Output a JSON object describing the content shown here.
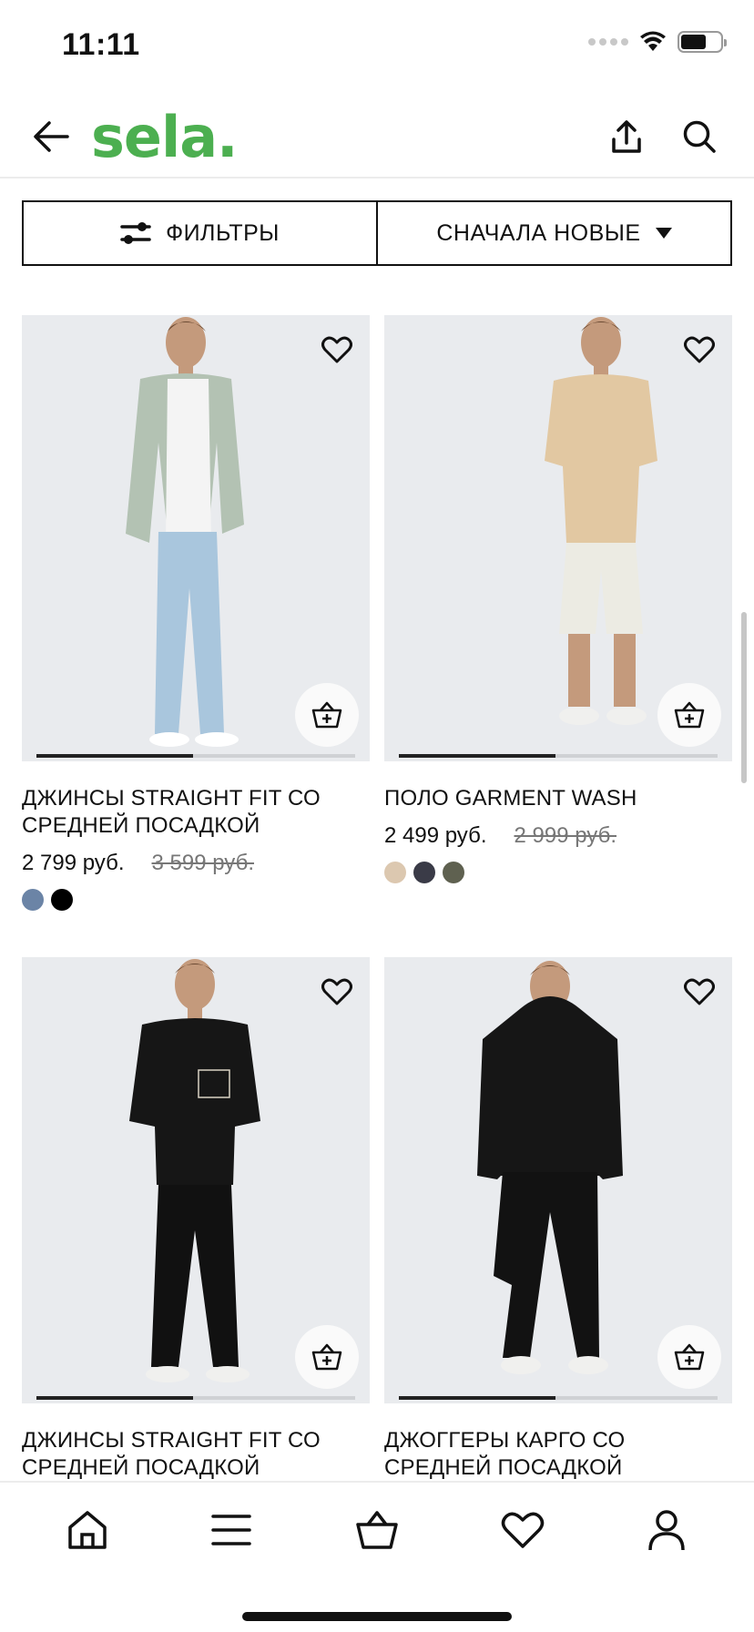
{
  "status_bar": {
    "time": "11:11"
  },
  "header": {
    "logo": "sela."
  },
  "filters": {
    "filter_label": "ФИЛЬТРЫ",
    "sort_label": "СНАЧАЛА НОВЫЕ"
  },
  "products": [
    {
      "name": "ДЖИНСЫ STRAIGHT FIT СО СРЕДНЕЙ ПОСАДКОЙ",
      "price": "2 799 руб.",
      "old_price": "3 599 руб.",
      "swatches": [
        "#6b84a6",
        "#000000"
      ],
      "image_progress": 0.49
    },
    {
      "name": "ПОЛО GARMENT WASH",
      "price": "2 499 руб.",
      "old_price": "2 999 руб.",
      "swatches": [
        "#dcc8b0",
        "#3a3b47",
        "#5f6150"
      ],
      "image_progress": 0.49
    },
    {
      "name": "ДЖИНСЫ STRAIGHT FIT СО СРЕДНЕЙ ПОСАДКОЙ",
      "price": "",
      "old_price": "",
      "swatches": [],
      "image_progress": 0.49
    },
    {
      "name": "ДЖОГГЕРЫ КАРГО СО СРЕДНЕЙ ПОСАДКОЙ",
      "price": "",
      "old_price": "",
      "swatches": [],
      "image_progress": 0.49
    }
  ],
  "bottom_nav": {
    "items": [
      "home-icon",
      "menu-icon",
      "basket-icon",
      "heart-icon",
      "profile-icon"
    ]
  },
  "colors": {
    "brand_green": "#4caf50"
  }
}
